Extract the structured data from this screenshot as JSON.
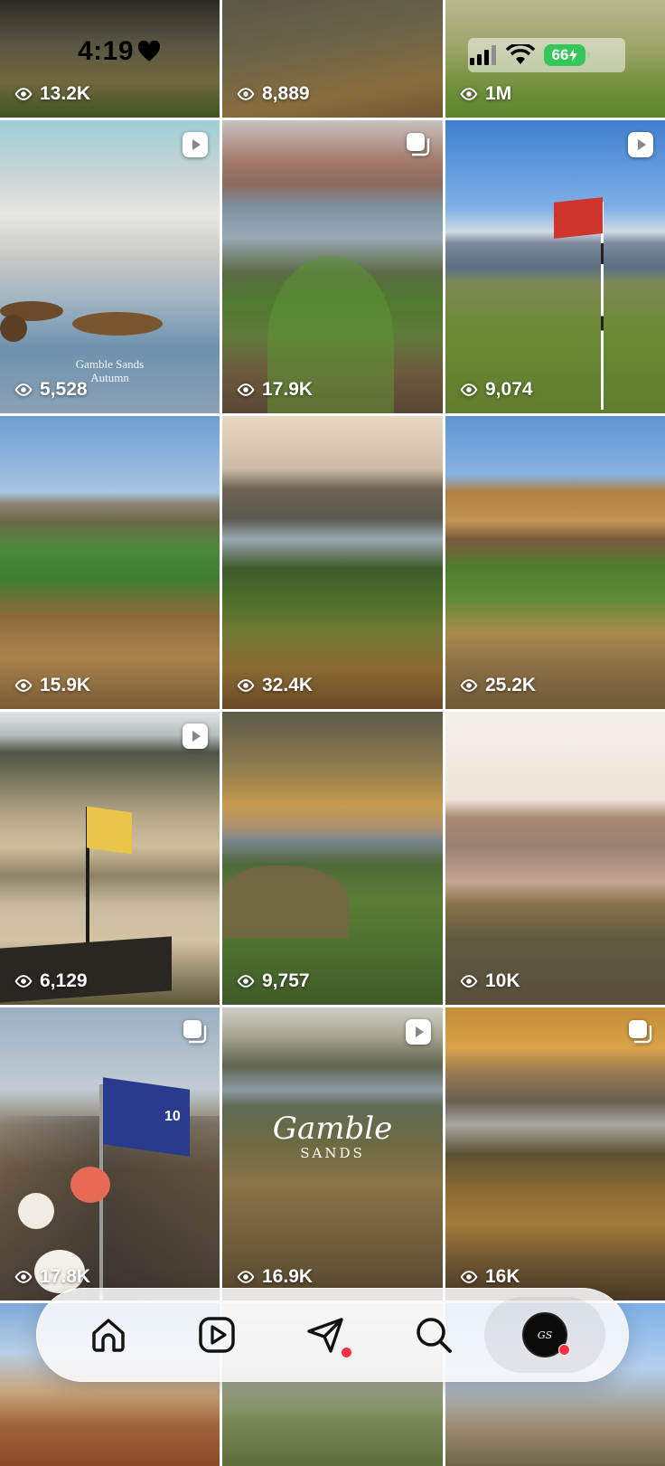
{
  "status_bar": {
    "time": "4:19",
    "battery": "66"
  },
  "grid": {
    "tiles": [
      {
        "views": "13.2K",
        "badge": ""
      },
      {
        "views": "8,889",
        "badge": ""
      },
      {
        "views": "1M",
        "badge": ""
      },
      {
        "views": "5,528",
        "badge": "reel",
        "caption_line1": "Gamble Sands",
        "caption_line2": "Autumn"
      },
      {
        "views": "17.9K",
        "badge": "carousel"
      },
      {
        "views": "9,074",
        "badge": "reel"
      },
      {
        "views": "15.9K",
        "badge": ""
      },
      {
        "views": "32.4K",
        "badge": ""
      },
      {
        "views": "25.2K",
        "badge": ""
      },
      {
        "views": "6,129",
        "badge": "reel"
      },
      {
        "views": "9,757",
        "badge": ""
      },
      {
        "views": "10K",
        "badge": ""
      },
      {
        "views": "17.8K",
        "badge": "carousel",
        "flag_number": "10"
      },
      {
        "views": "16.9K",
        "badge": "reel",
        "logo_script": "Gamble",
        "logo_sub": "SANDS"
      },
      {
        "views": "16K",
        "badge": "carousel"
      }
    ]
  },
  "nav": {
    "items": [
      {
        "name": "home",
        "icon": "home-icon",
        "badge": false
      },
      {
        "name": "reels",
        "icon": "reels-icon",
        "badge": false
      },
      {
        "name": "messages",
        "icon": "send-icon",
        "badge": true
      },
      {
        "name": "search",
        "icon": "search-icon",
        "badge": false
      },
      {
        "name": "profile",
        "icon": "avatar",
        "badge": true,
        "active": true
      }
    ]
  },
  "colors": {
    "notification_dot": "#ff3040",
    "battery": "#34c759"
  }
}
